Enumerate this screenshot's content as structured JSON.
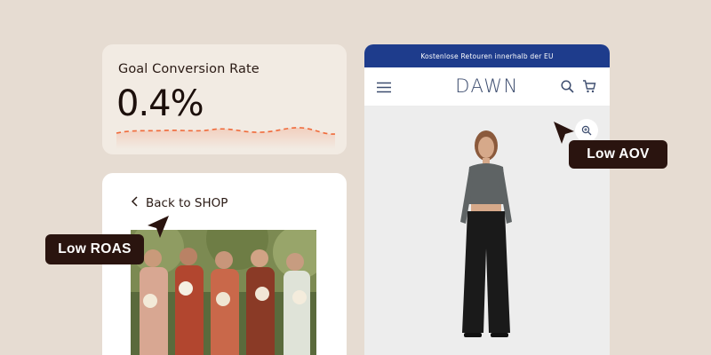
{
  "metric": {
    "title": "Goal Conversion Rate",
    "value": "0.4%",
    "sparkline_color": "#f06a3a"
  },
  "shop_card": {
    "back_icon": "chevron-left-icon",
    "back_label": "Back to SHOP"
  },
  "store": {
    "announcement": "Kostenlose Retouren innerhalb der EU",
    "announcement_bg": "#1e3c8c",
    "brand": "DAWN",
    "menu_icon": "hamburger-menu-icon",
    "search_icon": "search-icon",
    "cart_icon": "cart-icon",
    "zoom_icon": "zoom-in-icon"
  },
  "callouts": {
    "aov": "Low AOV",
    "roas": "Low ROAS"
  },
  "colors": {
    "background": "#e6dcd2",
    "card": "#f2ebe3",
    "tag": "#2a140f"
  }
}
